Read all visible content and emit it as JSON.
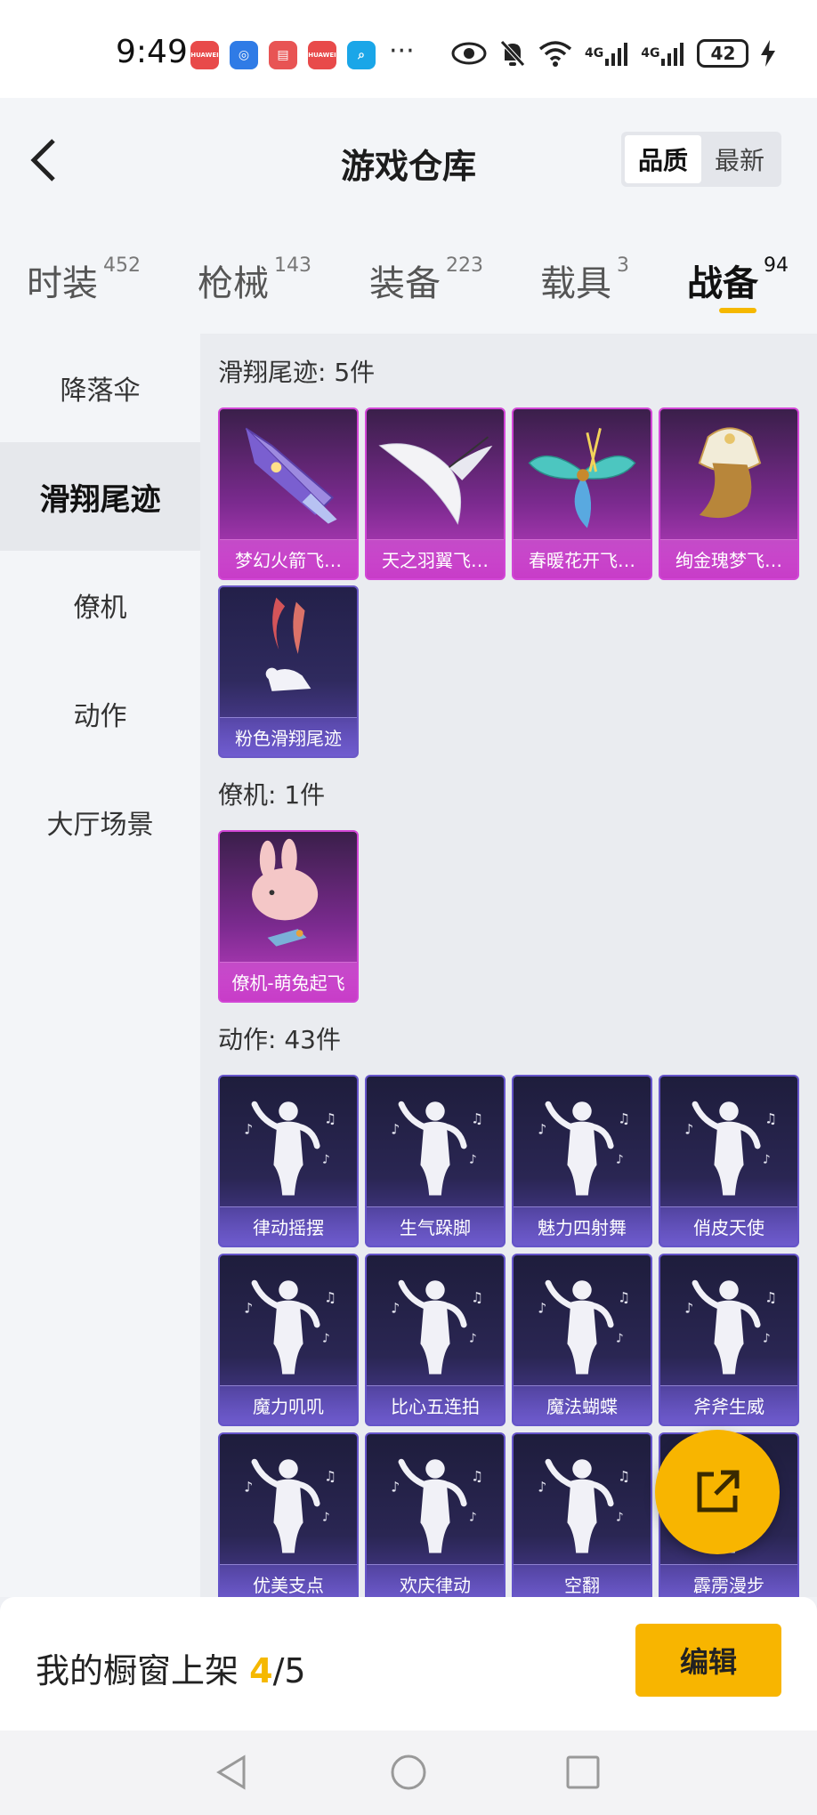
{
  "status_bar": {
    "time": "9:49",
    "apps": [
      {
        "icon": "huawei-app-icon",
        "color": "#e84a4a",
        "label": "HUAWEI"
      },
      {
        "icon": "assistant-app-icon",
        "color": "#2f7be6",
        "label": ""
      },
      {
        "icon": "books-app-icon",
        "color": "#e85454",
        "label": ""
      },
      {
        "icon": "huawei-app-icon",
        "color": "#e84a4a",
        "label": "HUAWEI"
      },
      {
        "icon": "search-app-icon",
        "color": "#1aa6e8",
        "label": ""
      }
    ],
    "more": "···",
    "signal1": "4G",
    "signal2": "4G",
    "battery": "42"
  },
  "header": {
    "title": "游戏仓库",
    "sort_options": [
      "品质",
      "最新"
    ],
    "sort_active": "品质"
  },
  "tabs": [
    {
      "label": "时装",
      "count": "452"
    },
    {
      "label": "枪械",
      "count": "143"
    },
    {
      "label": "装备",
      "count": "223"
    },
    {
      "label": "载具",
      "count": "3"
    },
    {
      "label": "战备",
      "count": "94",
      "active": true
    }
  ],
  "sidebar": {
    "items": [
      {
        "label": "降落伞"
      },
      {
        "label": "滑翔尾迹",
        "active": true
      },
      {
        "label": "僚机"
      },
      {
        "label": "动作"
      },
      {
        "label": "大厅场景"
      }
    ]
  },
  "sections": [
    {
      "title": "滑翔尾迹: 5件",
      "items": [
        {
          "label": "梦幻火箭飞…",
          "style": "purple",
          "art": "rocket-wing"
        },
        {
          "label": "天之羽翼飞…",
          "style": "purple",
          "art": "feather-wing"
        },
        {
          "label": "春暖花开飞…",
          "style": "purple",
          "art": "butterfly-wing"
        },
        {
          "label": "绚金瑰梦飞…",
          "style": "purple",
          "art": "gold-dress"
        },
        {
          "label": "粉色滑翔尾迹",
          "style": "dark",
          "art": "pink-smoke"
        }
      ]
    },
    {
      "title": "僚机: 1件",
      "items": [
        {
          "label": "僚机-萌兔起飞",
          "style": "purple",
          "art": "bunny"
        }
      ]
    },
    {
      "title": "动作: 43件",
      "items": [
        {
          "label": "律动摇摆",
          "style": "emote",
          "art": "dancer"
        },
        {
          "label": "生气跺脚",
          "style": "emote",
          "art": "dancer"
        },
        {
          "label": "魅力四射舞",
          "style": "emote",
          "art": "dancer"
        },
        {
          "label": "俏皮天使",
          "style": "emote",
          "art": "dancer"
        },
        {
          "label": "魔力叽叽",
          "style": "emote",
          "art": "dancer"
        },
        {
          "label": "比心五连拍",
          "style": "emote",
          "art": "dancer"
        },
        {
          "label": "魔法蝴蝶",
          "style": "emote",
          "art": "dancer"
        },
        {
          "label": "斧斧生威",
          "style": "emote",
          "art": "dancer"
        },
        {
          "label": "优美支点",
          "style": "emote",
          "art": "dancer"
        },
        {
          "label": "欢庆律动",
          "style": "emote",
          "art": "dancer"
        },
        {
          "label": "空翻",
          "style": "emote",
          "art": "dancer"
        },
        {
          "label": "霹雳漫步",
          "style": "emote",
          "art": "dancer"
        }
      ]
    }
  ],
  "bottom_bar": {
    "label": "我的橱窗上架",
    "current": "4",
    "total": "/5",
    "edit_label": "编辑"
  },
  "colors": {
    "accent": "#f8b500",
    "card_purple": "#c33fc6",
    "card_emote": "#4f3fa0"
  }
}
